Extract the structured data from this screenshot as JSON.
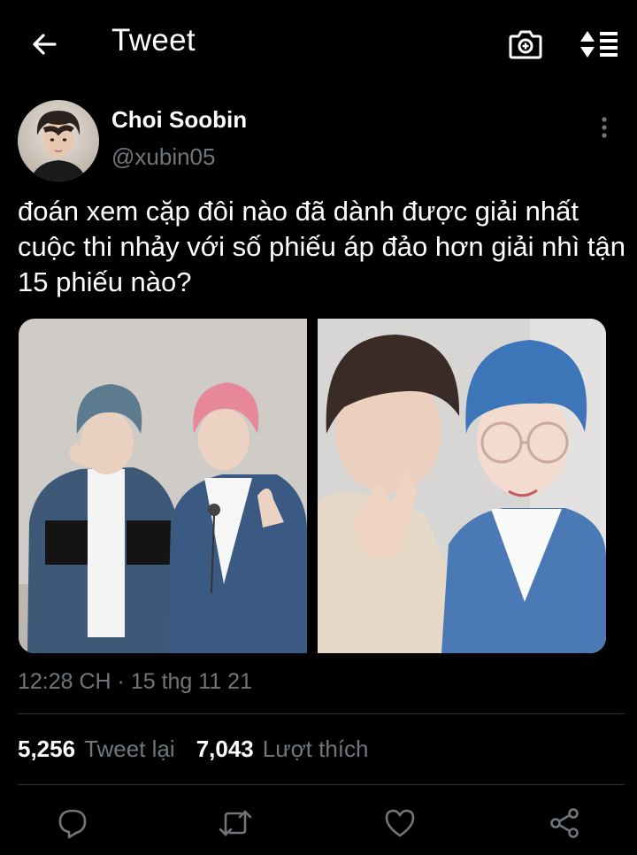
{
  "header": {
    "title": "Tweet"
  },
  "icons": {
    "back": "arrow-left-icon",
    "camera": "camera-icon",
    "sort": "sort-icon",
    "more": "more-vertical-icon",
    "reply": "reply-icon",
    "retweet": "retweet-icon",
    "like": "heart-icon",
    "share": "share-icon"
  },
  "tweet": {
    "author": {
      "name": "Choi Soobin",
      "handle": "@xubin05"
    },
    "text": "đoán xem cặp đôi nào đã dành được giải nhất cuộc thi nhảy với số phiếu áp đảo hơn giải nhì tận 15 phiếu nào?",
    "timestamp": "12:28 CH · 15 thg 11 21",
    "stats": {
      "retweets": "5,256",
      "retweets_label": "Tweet lại",
      "likes": "7,043",
      "likes_label": "Lượt thích"
    }
  },
  "colors": {
    "background": "#000000",
    "text": "#ffffff",
    "secondary": "#71767b",
    "divider": "#2f3336"
  }
}
